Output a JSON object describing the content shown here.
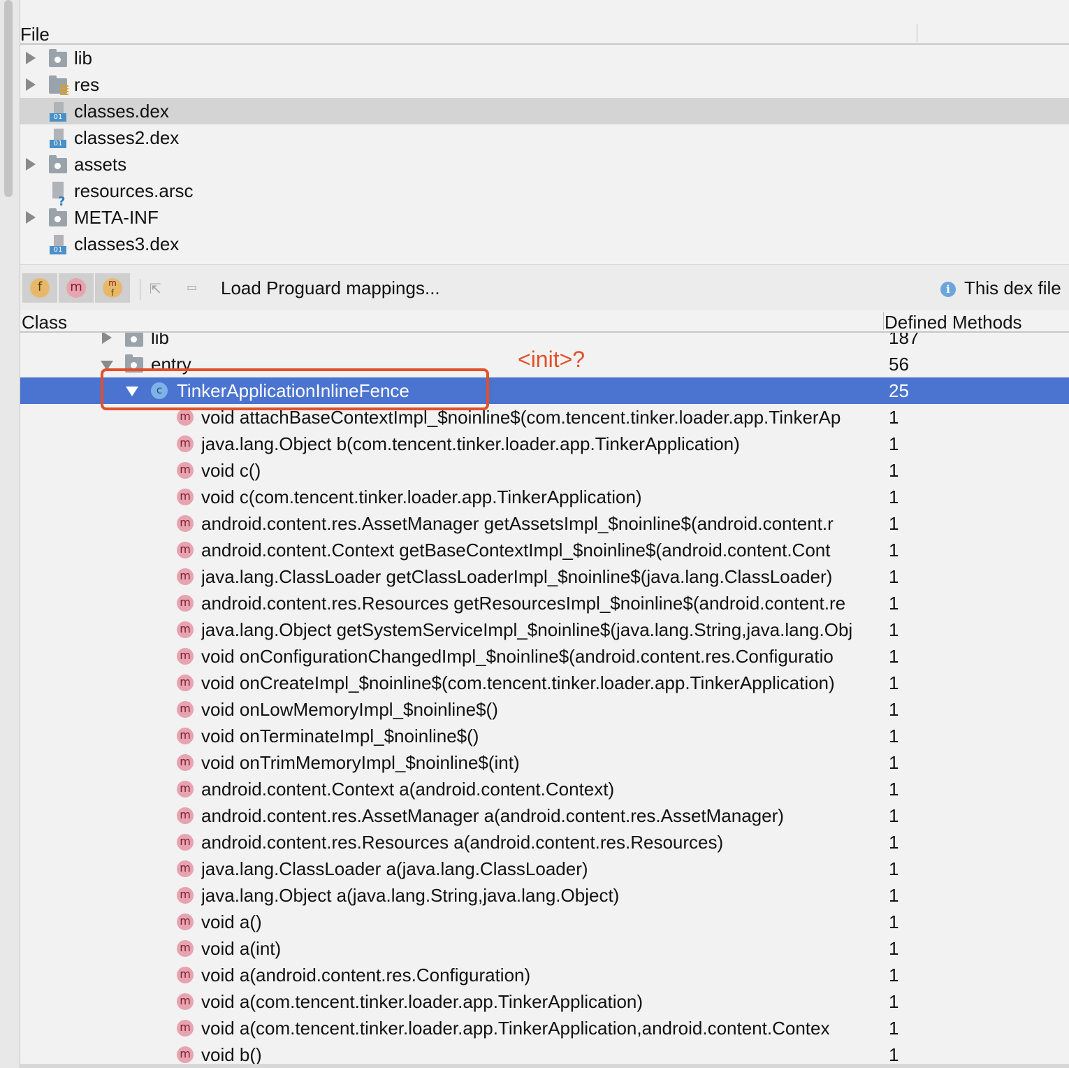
{
  "file_panel": {
    "header": "File",
    "rows": [
      {
        "label": "lib",
        "icon": "folder-icon",
        "expandable": true
      },
      {
        "label": "res",
        "icon": "resource-folder-icon",
        "expandable": true
      },
      {
        "label": "classes.dex",
        "icon": "dex-file-icon",
        "expandable": false,
        "selected": true
      },
      {
        "label": "classes2.dex",
        "icon": "dex-file-icon",
        "expandable": false
      },
      {
        "label": "assets",
        "icon": "folder-icon",
        "expandable": true
      },
      {
        "label": "resources.arsc",
        "icon": "unknown-file-icon",
        "expandable": false
      },
      {
        "label": "META-INF",
        "icon": "folder-icon",
        "expandable": true
      },
      {
        "label": "classes3.dex",
        "icon": "dex-file-icon",
        "expandable": false
      }
    ],
    "dex_badge": "01",
    "unknown_badge": "?"
  },
  "toolbar": {
    "field_toggle": "f",
    "method_toggle": "m",
    "ref_toggle_top": "m",
    "ref_toggle_sub": "f",
    "load_mappings": "Load Proguard mappings...",
    "info_icon": "i",
    "info_text": "This dex file"
  },
  "class_panel": {
    "col_class": "Class",
    "col_methods": "Defined Methods",
    "partial_lib": {
      "label": "lib",
      "count": "187"
    },
    "entry": {
      "label": "entry",
      "count": "56"
    },
    "class_node": {
      "label": "TinkerApplicationInlineFence",
      "count": "25",
      "icon_letter": "c"
    },
    "method_icon_letter": "m",
    "methods": [
      {
        "sig": "void attachBaseContextImpl_$noinline$(com.tencent.tinker.loader.app.TinkerAp",
        "count": "1"
      },
      {
        "sig": "java.lang.Object b(com.tencent.tinker.loader.app.TinkerApplication)",
        "count": "1"
      },
      {
        "sig": "void c()",
        "count": "1"
      },
      {
        "sig": "void c(com.tencent.tinker.loader.app.TinkerApplication)",
        "count": "1"
      },
      {
        "sig": "android.content.res.AssetManager getAssetsImpl_$noinline$(android.content.r",
        "count": "1"
      },
      {
        "sig": "android.content.Context getBaseContextImpl_$noinline$(android.content.Cont",
        "count": "1"
      },
      {
        "sig": "java.lang.ClassLoader getClassLoaderImpl_$noinline$(java.lang.ClassLoader)",
        "count": "1"
      },
      {
        "sig": "android.content.res.Resources getResourcesImpl_$noinline$(android.content.re",
        "count": "1"
      },
      {
        "sig": "java.lang.Object getSystemServiceImpl_$noinline$(java.lang.String,java.lang.Obj",
        "count": "1"
      },
      {
        "sig": "void onConfigurationChangedImpl_$noinline$(android.content.res.Configuratio",
        "count": "1"
      },
      {
        "sig": "void onCreateImpl_$noinline$(com.tencent.tinker.loader.app.TinkerApplication)",
        "count": "1"
      },
      {
        "sig": "void onLowMemoryImpl_$noinline$()",
        "count": "1"
      },
      {
        "sig": "void onTerminateImpl_$noinline$()",
        "count": "1"
      },
      {
        "sig": "void onTrimMemoryImpl_$noinline$(int)",
        "count": "1"
      },
      {
        "sig": "android.content.Context a(android.content.Context)",
        "count": "1"
      },
      {
        "sig": "android.content.res.AssetManager a(android.content.res.AssetManager)",
        "count": "1"
      },
      {
        "sig": "android.content.res.Resources a(android.content.res.Resources)",
        "count": "1"
      },
      {
        "sig": "java.lang.ClassLoader a(java.lang.ClassLoader)",
        "count": "1"
      },
      {
        "sig": "java.lang.Object a(java.lang.String,java.lang.Object)",
        "count": "1"
      },
      {
        "sig": "void a()",
        "count": "1"
      },
      {
        "sig": "void a(int)",
        "count": "1"
      },
      {
        "sig": "void a(android.content.res.Configuration)",
        "count": "1"
      },
      {
        "sig": "void a(com.tencent.tinker.loader.app.TinkerApplication)",
        "count": "1"
      },
      {
        "sig": "void a(com.tencent.tinker.loader.app.TinkerApplication,android.content.Contex",
        "count": "1"
      },
      {
        "sig": "void b()",
        "count": "1"
      }
    ]
  },
  "annotation": {
    "text": "<init>?",
    "color": "#e2502a"
  },
  "colors": {
    "selection": "#4a74d0",
    "file_selection": "#d4d4d4"
  }
}
